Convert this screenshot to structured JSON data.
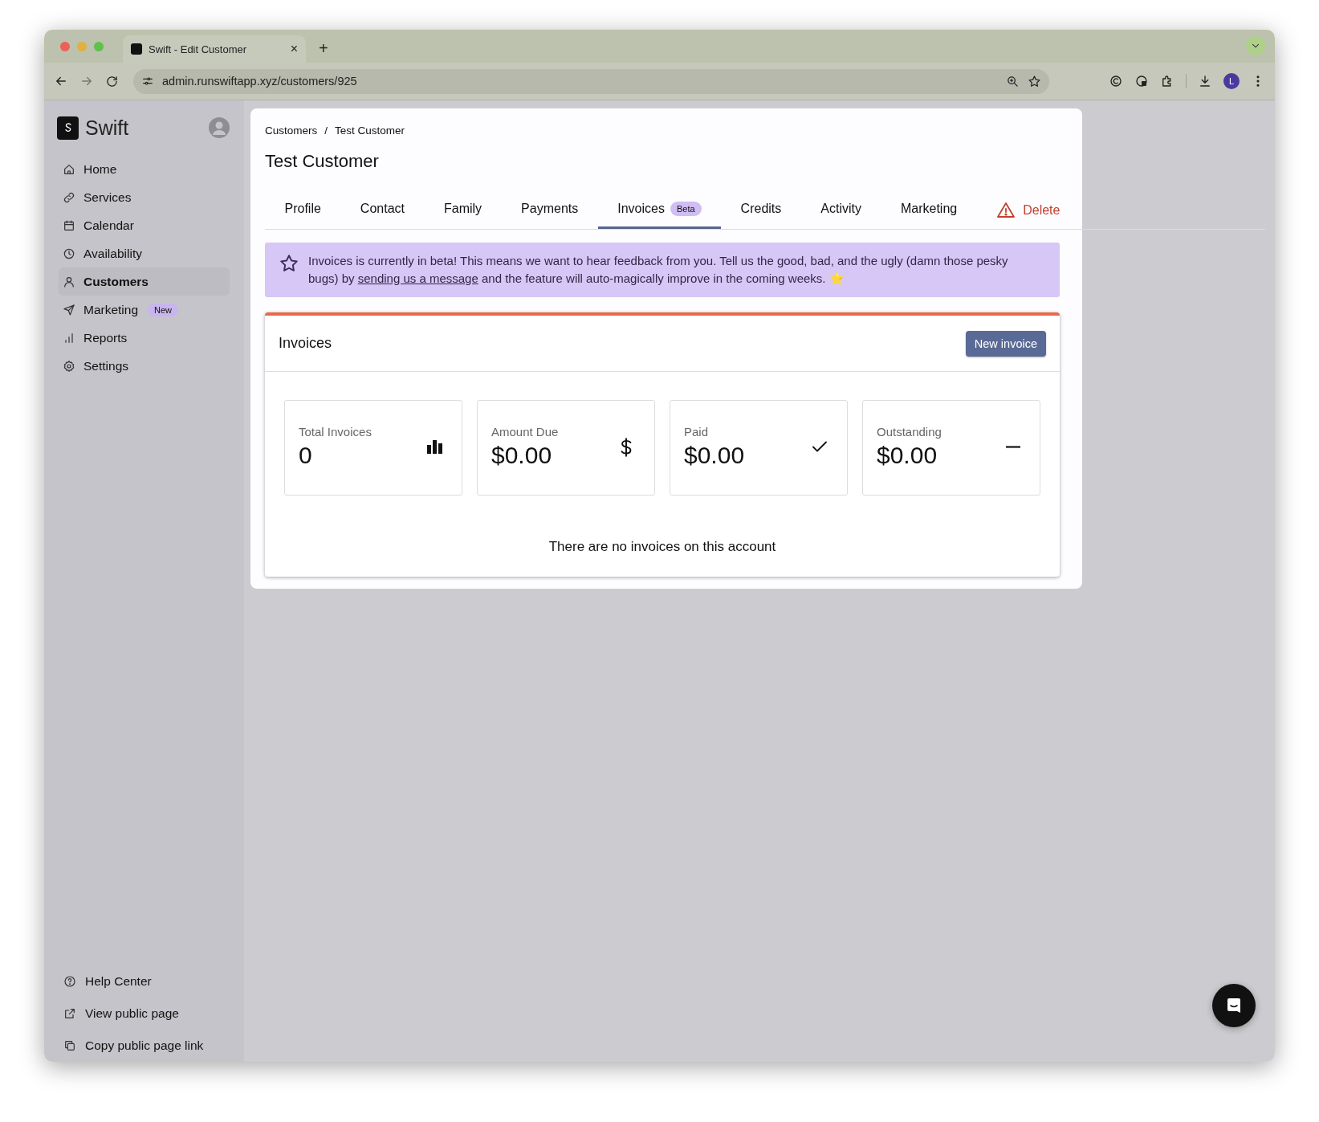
{
  "browser": {
    "tab_title": "Swift - Edit Customer",
    "tab_close": "×",
    "new_tab": "+",
    "url": "admin.runswiftapp.xyz/customers/925",
    "profile_initial": "L"
  },
  "sidebar": {
    "brand": "Swift",
    "items": [
      {
        "label": "Home",
        "selected": false
      },
      {
        "label": "Services",
        "selected": false
      },
      {
        "label": "Calendar",
        "selected": false
      },
      {
        "label": "Availability",
        "selected": false
      },
      {
        "label": "Customers",
        "selected": true
      },
      {
        "label": "Marketing",
        "badge": "New",
        "selected": false
      },
      {
        "label": "Reports",
        "selected": false
      },
      {
        "label": "Settings",
        "selected": false
      }
    ],
    "footer_items": [
      "Help Center",
      "View public page",
      "Copy public page link"
    ]
  },
  "breadcrumb": [
    "Customers",
    "Test Customer"
  ],
  "breadcrumb_separator": "/",
  "title": "Test Customer",
  "tabs": [
    {
      "label": "Profile",
      "kind": "tab",
      "selected": false
    },
    {
      "label": "Contact",
      "kind": "tab",
      "selected": false
    },
    {
      "label": "Family",
      "kind": "tab",
      "selected": false
    },
    {
      "label": "Payments",
      "kind": "tab",
      "selected": false
    },
    {
      "label": "Invoices",
      "badge": "Beta",
      "kind": "tab",
      "selected": true
    },
    {
      "label": "Credits",
      "kind": "tab",
      "selected": false
    },
    {
      "label": "Activity",
      "kind": "tab",
      "selected": false
    },
    {
      "label": "Marketing",
      "kind": "tab",
      "selected": false
    },
    {
      "label": "Delete",
      "kind": "danger",
      "selected": false
    }
  ],
  "banner": {
    "text_before": "Invoices is currently in beta! This means we want to hear feedback from you. Tell us the good, bad, and the ugly (damn those pesky bugs) by ",
    "link": "sending us a message",
    "text_after": " and the feature will auto-magically improve in the coming weeks. ⭐"
  },
  "invoices": {
    "title": "Invoices",
    "new_button": "New invoice",
    "stats": [
      {
        "label": "Total Invoices",
        "value": "0"
      },
      {
        "label": "Amount Due",
        "value": "$0.00"
      },
      {
        "label": "Paid",
        "value": "$0.00"
      },
      {
        "label": "Outstanding",
        "value": "$0.00"
      }
    ],
    "empty_message": "There are no invoices on this account"
  }
}
